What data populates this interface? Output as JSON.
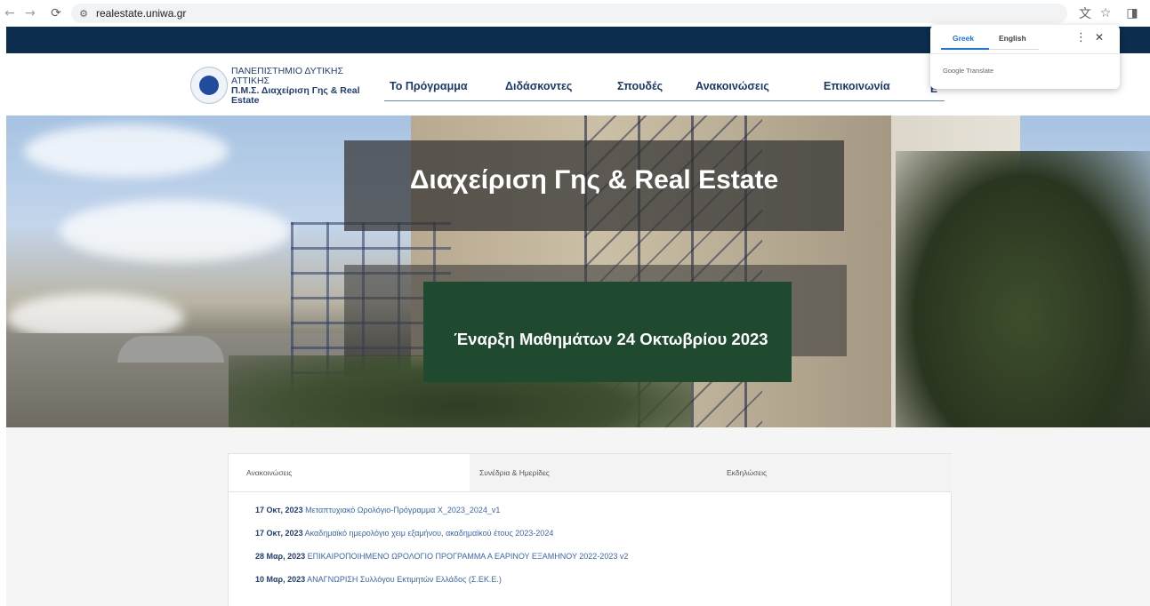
{
  "browser": {
    "back": "←",
    "forward": "→",
    "reload": "⟳",
    "site_icon": "⚙",
    "url": "realestate.uniwa.gr",
    "translate_icon": "文",
    "bookmark_icon": "☆",
    "sidepanel_icon": "◨"
  },
  "header": {
    "logo": {
      "line1": "ΠΑΝΕΠΙΣΤΗΜΙΟ ΔΥΤΙΚΗΣ ΑΤΤΙΚΗΣ",
      "line2": "Π.Μ.Σ. Διαχείριση Γης & Real",
      "line3": "Estate"
    },
    "menu": [
      "Το Πρόγραμμα",
      "Διδάσκοντες",
      "Σπουδές",
      "Ανακοινώσεις",
      "Επικοινωνία"
    ],
    "menu_peek": "Ε"
  },
  "translate_popup": {
    "tab_greek": "Greek",
    "tab_english": "English",
    "menu_icon": "⋮",
    "close_icon": "✕",
    "footer": "Google Translate"
  },
  "hero": {
    "title": "Διαχείριση Γης & Real Estate",
    "subtitle": "Έναρξη Μαθημάτων 24 Οκτωβρίου 2023"
  },
  "content": {
    "tabs": [
      "Ανακοινώσεις",
      "Συνέδρια & Ημερίδες",
      "Εκδηλώσεις"
    ],
    "news": [
      {
        "date": "17 Οκτ, 2023",
        "title": "Μεταπτυχιακό Ωρολόγιο-Πρόγραμμα Χ_2023_2024_v1"
      },
      {
        "date": "17 Οκτ, 2023",
        "title": "Ακαδημαϊκό ημερολόγιο χειμ εξαμήνου, ακαδημαϊκού έτους 2023-2024"
      },
      {
        "date": "28 Μαρ, 2023",
        "title": "ΕΠΙΚΑΙΡΟΠΟΙΗΜΕΝΟ ΩΡΟΛΟΓΙΟ ΠΡΟΓΡΑΜΜΑ Α ΕΑΡΙΝΟΥ ΕΞΑΜΗΝΟΥ 2022-2023 v2"
      },
      {
        "date": "10 Μαρ, 2023",
        "title": "ΑΝΑΓΝΩΡΙΣΗ Συλλόγου Εκτιμητών Ελλάδος (Σ.ΕΚ.Ε.)"
      }
    ]
  },
  "colors": {
    "top_strip": "#0c2d4d",
    "menu_text": "#1a3a6e",
    "subtitle_box": "#1f4a30",
    "link": "#3a66b7"
  }
}
